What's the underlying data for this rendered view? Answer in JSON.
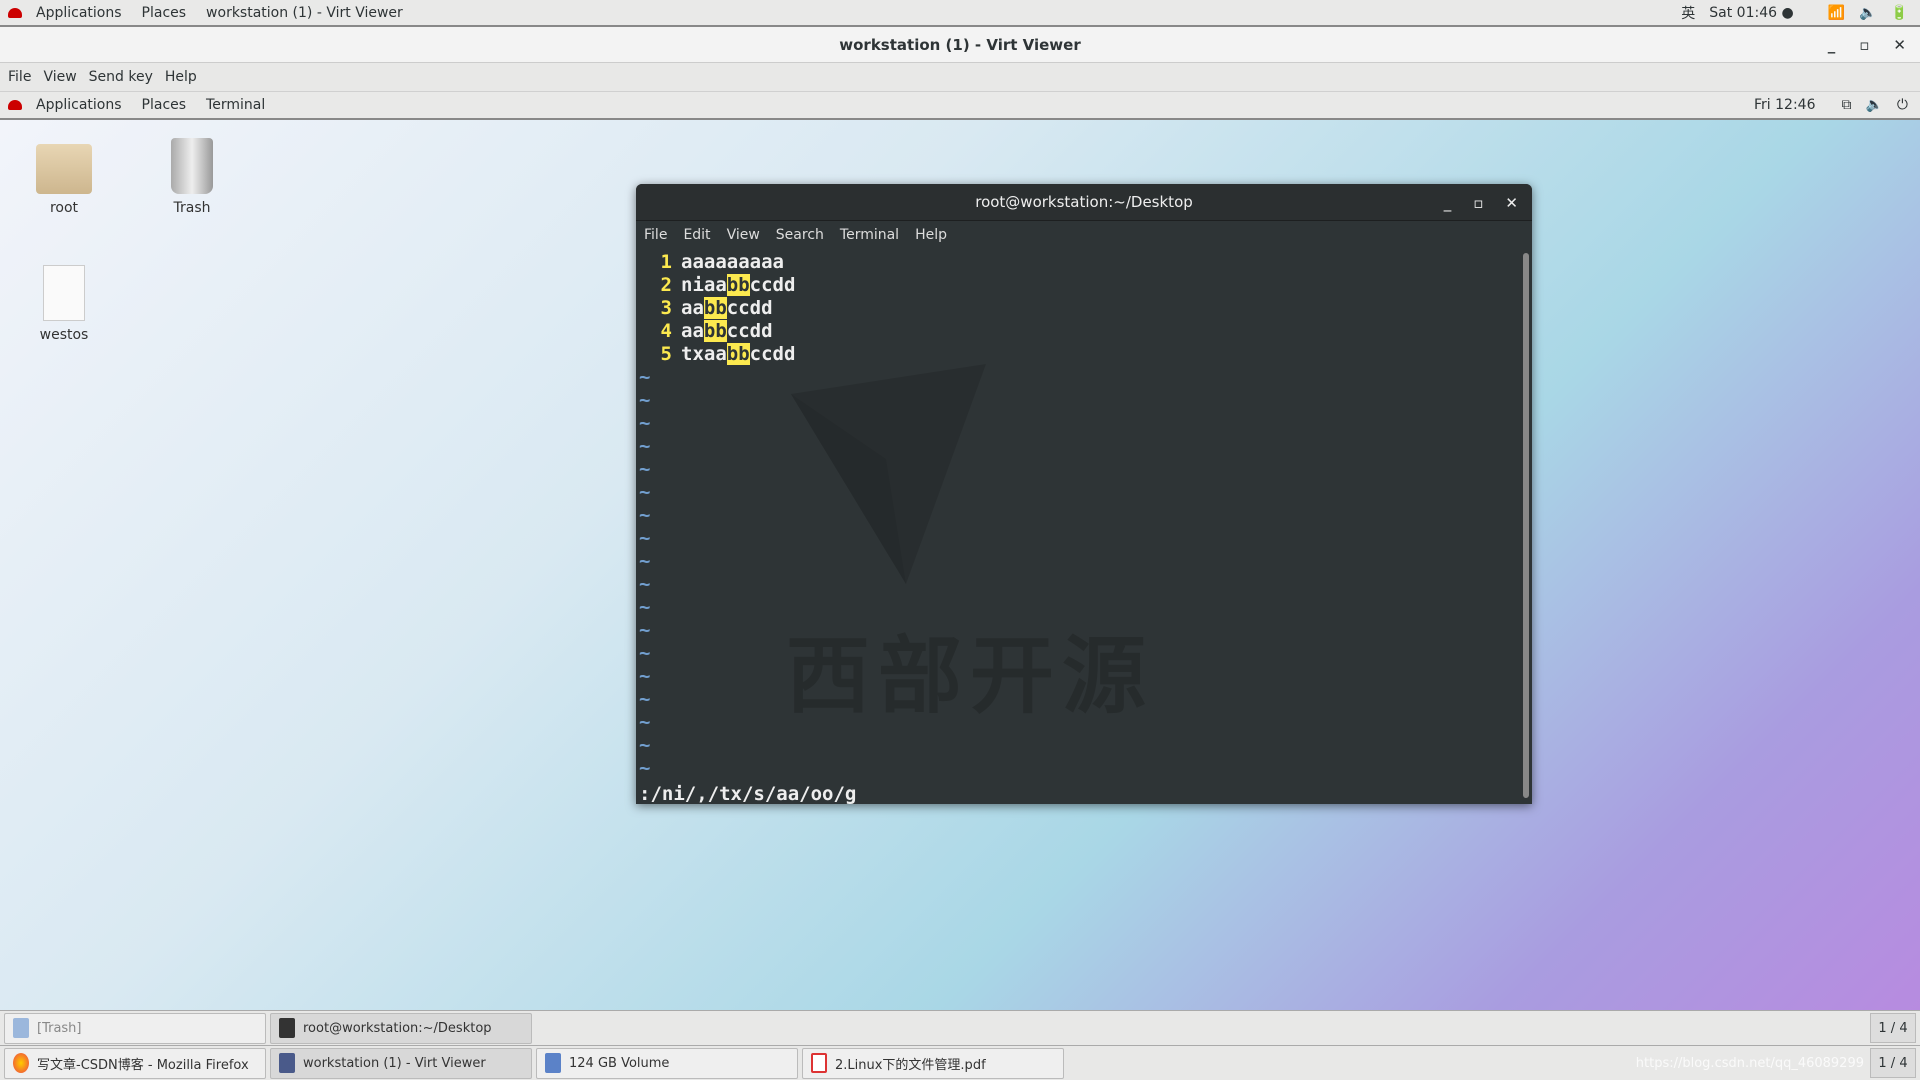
{
  "host_panel": {
    "applications": "Applications",
    "places": "Places",
    "active_window": "workstation (1) - Virt Viewer",
    "input_method": "英",
    "clock": "Sat 01:46 ●"
  },
  "viewer": {
    "title": "workstation (1) - Virt Viewer",
    "menu": [
      "File",
      "View",
      "Send key",
      "Help"
    ]
  },
  "guest_panel": {
    "applications": "Applications",
    "places": "Places",
    "active_app": "Terminal",
    "clock": "Fri 12:46"
  },
  "desktop_icons": [
    {
      "label": "root",
      "icon": "home-folder-icon"
    },
    {
      "label": "Trash",
      "icon": "trash-icon"
    },
    {
      "label": "westos",
      "icon": "text-file-icon"
    }
  ],
  "terminal": {
    "title": "root@workstation:~/Desktop",
    "menu": [
      "File",
      "Edit",
      "View",
      "Search",
      "Terminal",
      "Help"
    ],
    "lines": [
      {
        "num": "1",
        "pre": "aaaaaaaaa",
        "hl": "",
        "post": ""
      },
      {
        "num": "2",
        "pre": "niaa",
        "hl": "bb",
        "post": "ccdd"
      },
      {
        "num": "3",
        "pre": "aa",
        "hl": "bb",
        "post": "ccdd"
      },
      {
        "num": "4",
        "pre": "aa",
        "hl": "bb",
        "post": "ccdd"
      },
      {
        "num": "5",
        "pre": "txaa",
        "hl": "bb",
        "post": "ccdd"
      }
    ],
    "command": ":/ni/,/tx/s/aa/oo/g",
    "watermark": "西部开源",
    "highlight_color": "#fce94f"
  },
  "guest_taskbar": {
    "tasks": [
      "[Trash]",
      "root@workstation:~/Desktop"
    ],
    "pager": "1 / 4"
  },
  "host_taskbar": {
    "tasks": [
      "写文章-CSDN博客 - Mozilla Firefox",
      "workstation (1) - Virt Viewer",
      "124 GB Volume",
      "2.Linux下的文件管理.pdf"
    ],
    "pager": "1 / 4",
    "url_watermark": "https://blog.csdn.net/qq_46089299"
  }
}
